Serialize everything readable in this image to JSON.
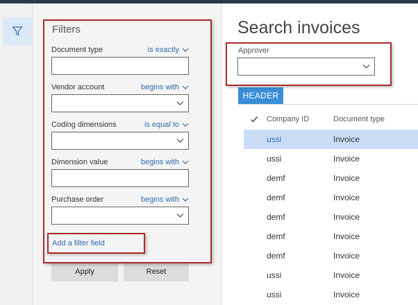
{
  "filters": {
    "title": "Filters",
    "fields": [
      {
        "label": "Document type",
        "operator": "is exactly",
        "value": "",
        "has_dropdown": false
      },
      {
        "label": "Vendor account",
        "operator": "begins with",
        "value": "",
        "has_dropdown": true
      },
      {
        "label": "Coding dimensions",
        "operator": "is equal to",
        "value": "",
        "has_dropdown": true
      },
      {
        "label": "Dimension value",
        "operator": "begins with",
        "value": "",
        "has_dropdown": false
      },
      {
        "label": "Purchase order",
        "operator": "begins with",
        "value": "",
        "has_dropdown": true
      }
    ],
    "add_filter_label": "Add a filter field",
    "apply_label": "Apply",
    "reset_label": "Reset"
  },
  "main": {
    "title": "Search invoices",
    "approver_label": "Approver",
    "approver_value": "",
    "tab_label": "HEADER",
    "columns": [
      "Company ID",
      "Document type"
    ],
    "rows": [
      {
        "company": "ussi",
        "doctype": "Invoice",
        "selected": true
      },
      {
        "company": "ussi",
        "doctype": "Invoice",
        "selected": false
      },
      {
        "company": "demf",
        "doctype": "Invoice",
        "selected": false
      },
      {
        "company": "demf",
        "doctype": "Invoice",
        "selected": false
      },
      {
        "company": "demf",
        "doctype": "Invoice",
        "selected": false
      },
      {
        "company": "demf",
        "doctype": "Invoice",
        "selected": false
      },
      {
        "company": "demf",
        "doctype": "Invoice",
        "selected": false
      },
      {
        "company": "ussi",
        "doctype": "Invoice",
        "selected": false
      },
      {
        "company": "ussi",
        "doctype": "Invoice",
        "selected": false
      }
    ]
  },
  "icons": {
    "rail": "filter-icon",
    "dropdown": "chevron-down-icon",
    "check": "checkmark-icon"
  },
  "colors": {
    "accent": "#3a8fd8",
    "link": "#2e6ab1",
    "selected_row": "#c9def5",
    "highlight_box": "#a92a2a"
  }
}
